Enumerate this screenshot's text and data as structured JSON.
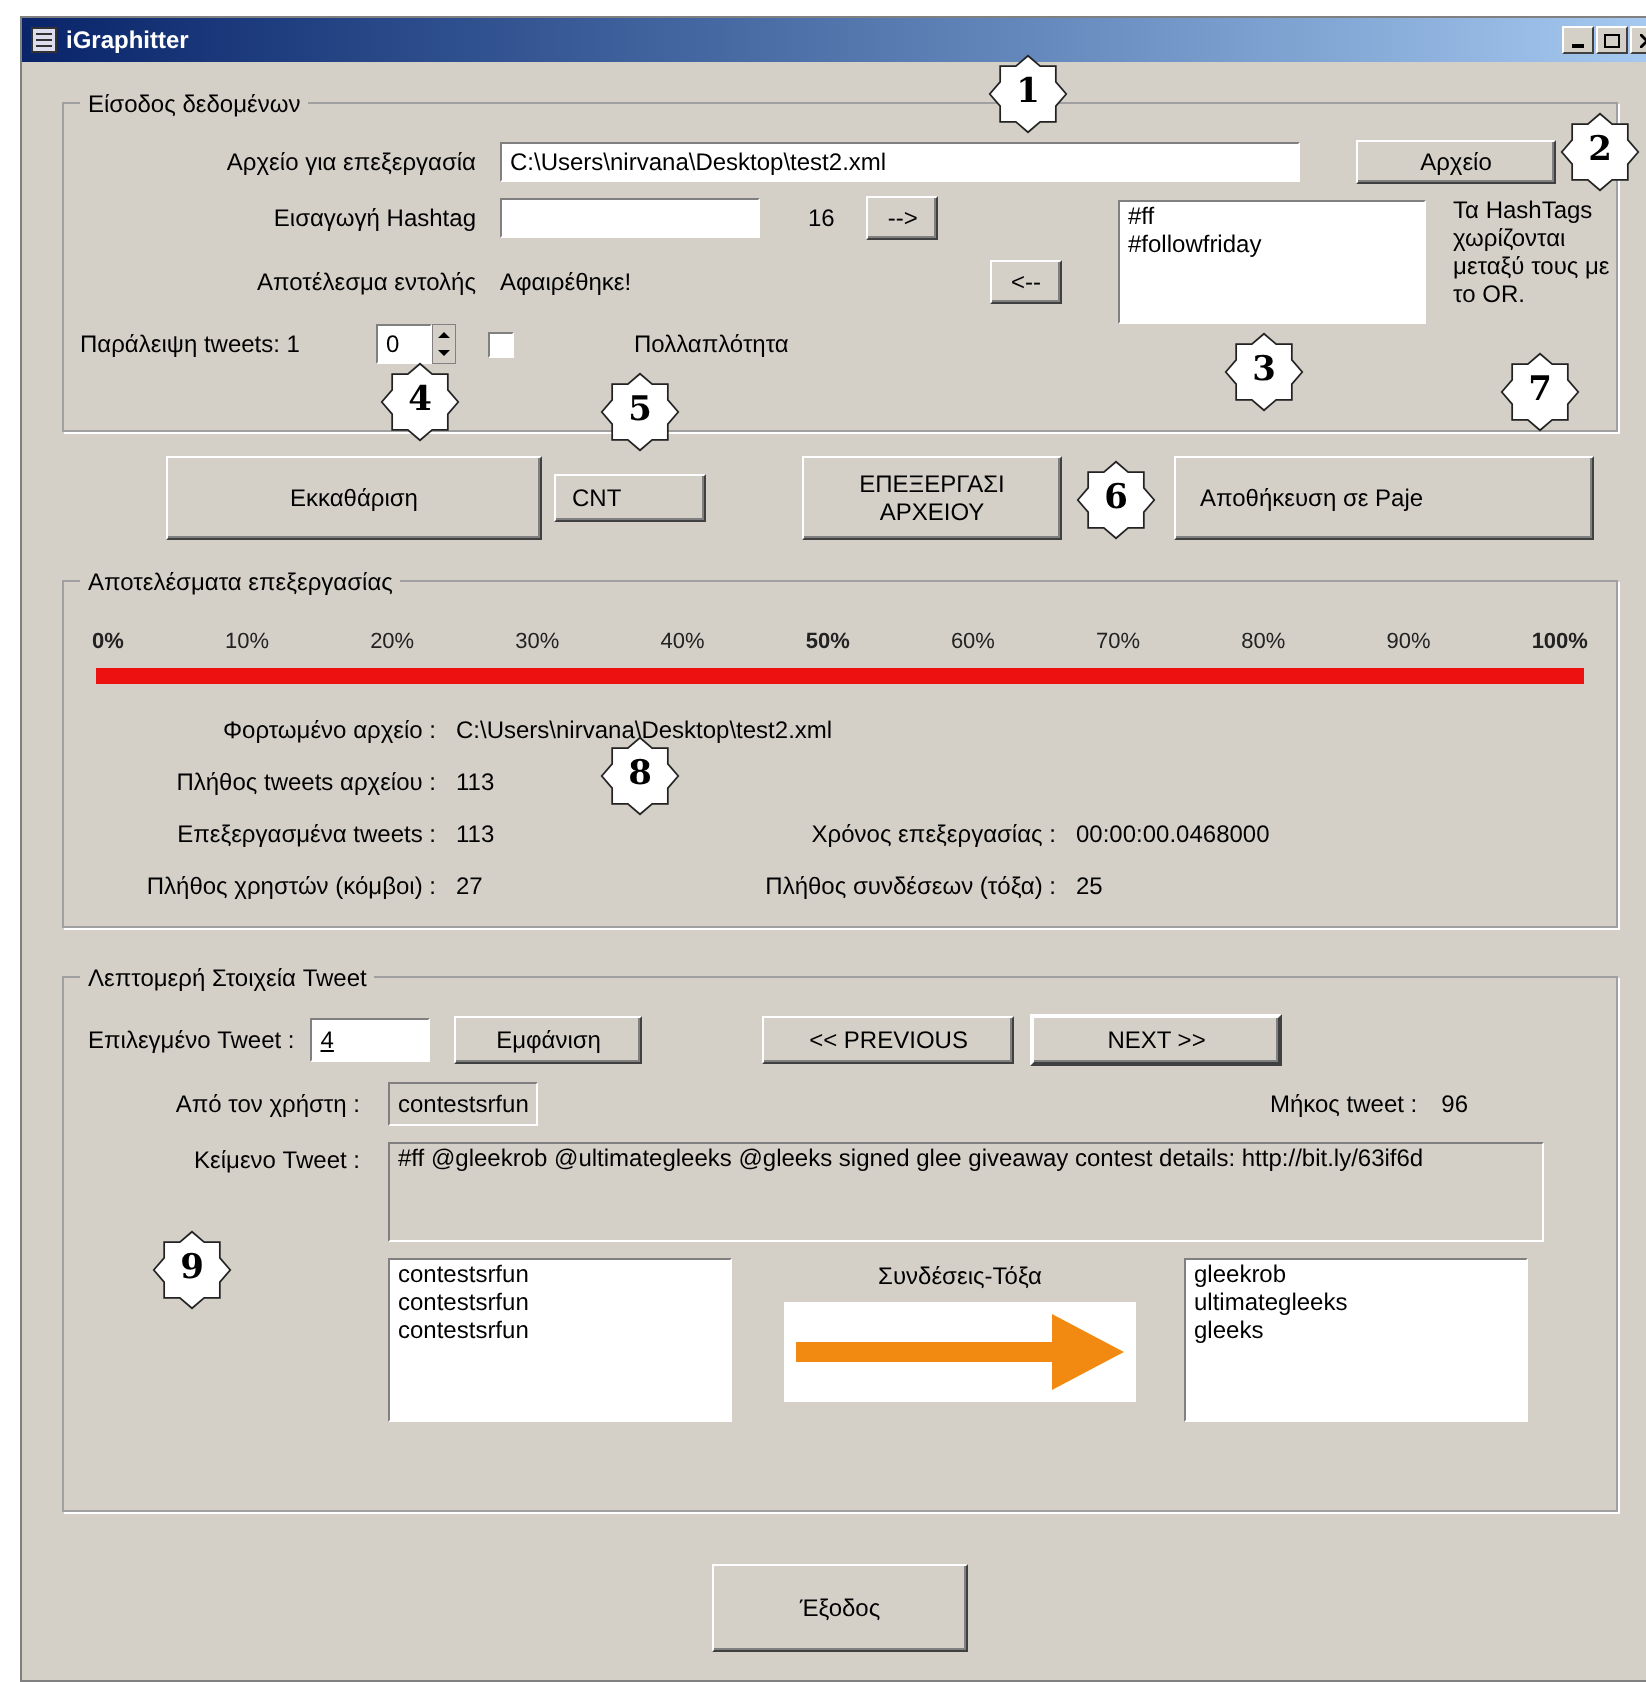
{
  "window": {
    "title": "iGraphitter"
  },
  "input_group": {
    "title": "Είσοδος δεδομένων",
    "file_label": "Αρχείο για επεξεργασία",
    "file_value": "C:\\Users\\nirvana\\Desktop\\test2.xml",
    "file_button": "Αρχείο",
    "hashtag_label": "Εισαγωγή Hashtag",
    "hashtag_count": "16",
    "add_button": "-->",
    "remove_button": "<--",
    "hashtags": [
      "#ff",
      "#followfriday"
    ],
    "note": "Τα HashTags χωρίζονται μεταξύ τους με το OR.",
    "result_label": "Αποτέλεσμα εντολής",
    "result_value": "Αφαιρέθηκε!",
    "skip_label": "Παράλειψη tweets: 1",
    "skip_value": "0",
    "multiplicity": {
      "label": "Πολλαπλότητα",
      "checked": false
    }
  },
  "actions": {
    "clear": "Εκκαθάριση",
    "cnt": "CNT",
    "process": [
      "ΕΠΕΞΕΡΓΑΣΙ",
      "ΑΡΧΕΙΟΥ"
    ],
    "save": "Αποθήκευση σε Paje"
  },
  "results_group": {
    "title": "Αποτελέσματα επεξεργασίας",
    "progress": {
      "level": 1,
      "ticks": [
        {
          "label": "0%",
          "bold": true
        },
        {
          "label": "10%",
          "bold": false
        },
        {
          "label": "20%",
          "bold": false
        },
        {
          "label": "30%",
          "bold": false
        },
        {
          "label": "40%",
          "bold": false
        },
        {
          "label": "50%",
          "bold": true
        },
        {
          "label": "60%",
          "bold": false
        },
        {
          "label": "70%",
          "bold": false
        },
        {
          "label": "80%",
          "bold": false
        },
        {
          "label": "90%",
          "bold": false
        },
        {
          "label": "100%",
          "bold": true
        }
      ]
    },
    "loaded_label": "Φορτωμένο αρχείο :",
    "loaded_value": "C:\\Users\\nirvana\\Desktop\\test2.xml",
    "tweets_label": "Πλήθος tweets αρχείου :",
    "tweets_value": "113",
    "processed_label": "Επεξεργασμένα tweets :",
    "processed_value": "113",
    "time_label": "Χρόνος επεξεργασίας :",
    "time_value": "00:00:00.0468000",
    "users_label": "Πλήθος χρηστών (κόμβοι) :",
    "users_value": "27",
    "edges_label": "Πλήθος συνδέσεων (τόξα) :",
    "edges_value": "25"
  },
  "details_group": {
    "title": "Λεπτομερή Στοιχεία Tweet",
    "selected_label": "Επιλεγμένο Tweet :",
    "selected_value": "4",
    "show_button": "Εμφάνιση",
    "prev_button": "<< PREVIOUS",
    "next_button": "NEXT >>",
    "user_label": "Από τον χρήστη :",
    "user_value": "contestsrfun",
    "length_label": "Μήκος tweet :",
    "length_value": "96",
    "text_label": "Κείμενο Tweet :",
    "text_value": "#ff @gleekrob @ultimategleeks @gleeks signed glee giveaway contest details: http://bit.ly/63if6d",
    "edges_title": "Συνδέσεις-Τόξα",
    "sources": [
      "contestsrfun",
      "contestsrfun",
      "contestsrfun"
    ],
    "targets": [
      "gleekrob",
      "ultimategleeks",
      "gleeks"
    ]
  },
  "exit_button": "Έξοδος",
  "callouts": [
    "1",
    "2",
    "3",
    "4",
    "5",
    "6",
    "7",
    "8",
    "9"
  ]
}
